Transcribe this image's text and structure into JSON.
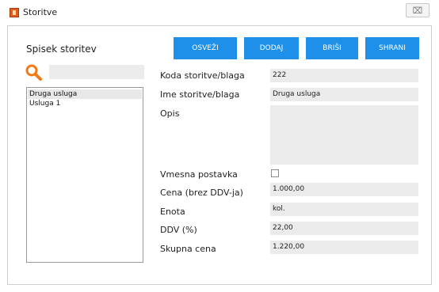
{
  "window": {
    "title": "Storitve",
    "close_glyph": "⌧"
  },
  "sidebar": {
    "title": "Spisek storitev",
    "search_value": "",
    "items": [
      {
        "label": "Druga usluga",
        "selected": true
      },
      {
        "label": "Usluga 1",
        "selected": false
      }
    ]
  },
  "toolbar": {
    "refresh_label": "OSVEŽI",
    "add_label": "DODAJ",
    "delete_label": "BRIŠI",
    "save_label": "SHRANI"
  },
  "form": {
    "code_label": "Koda storitve/blaga",
    "code_value": "222",
    "name_label": "Ime storitve/blaga",
    "name_value": "Druga usluga",
    "description_label": "Opis",
    "description_value": "",
    "intermediate_label": "Vmesna postavka",
    "intermediate_checked": false,
    "price_label": "Cena (brez DDV-ja)",
    "price_value": "1.000,00",
    "unit_label": "Enota",
    "unit_value": "kol.",
    "vat_label": "DDV (%)",
    "vat_value": "22,00",
    "total_label": "Skupna cena",
    "total_value": "1.220,00"
  },
  "colors": {
    "accent": "#1e90ea",
    "field_bg": "#ebebeb",
    "search_icon": "#f07a18"
  }
}
